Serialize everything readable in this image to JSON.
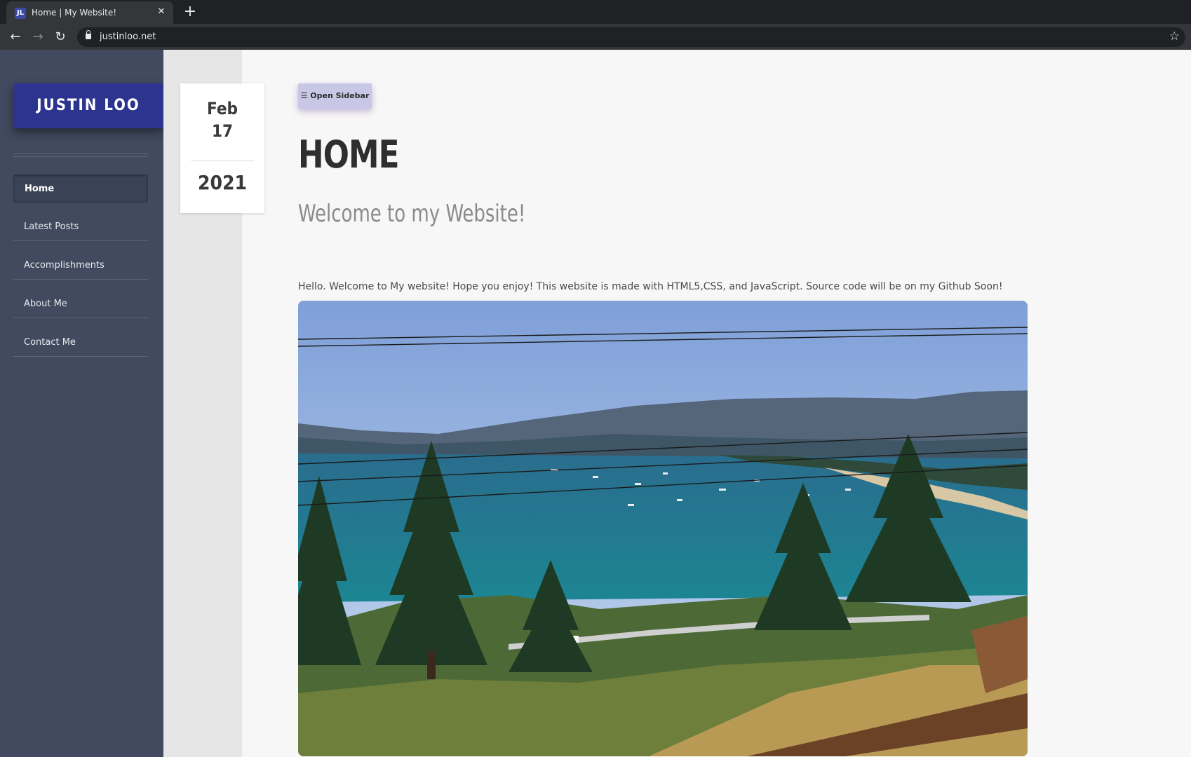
{
  "browser": {
    "tab_title": "Home | My Website!",
    "favicon_text": "JL",
    "url": "justinloo.net",
    "icons": [
      "back-arrow-icon",
      "forward-arrow-icon",
      "reload-icon",
      "lock-icon",
      "star-icon",
      "close-icon",
      "plus-icon"
    ]
  },
  "sidebar": {
    "brand": "JUSTIN LOO",
    "items": [
      {
        "label": "Home",
        "active": true
      },
      {
        "label": "Latest Posts",
        "active": false
      },
      {
        "label": "Accomplishments",
        "active": false
      },
      {
        "label": "About Me",
        "active": false
      },
      {
        "label": "Contact Me",
        "active": false
      }
    ]
  },
  "date": {
    "month": "Feb",
    "day": "17",
    "year": "2021"
  },
  "main": {
    "open_sidebar_label": "☰ Open Sidebar",
    "title": "HOME",
    "subtitle": "Welcome to my Website!",
    "intro": "Hello. Welcome to My website! Hope you enjoy! This website is made with HTML5,CSS, and JavaScript. Source code will be on my Github Soon!"
  },
  "colors": {
    "brand_bg": "#2c3490",
    "sidebar_bg": "#414a5e",
    "button_bg": "#c8c7e6",
    "chrome_bg": "#202124"
  }
}
